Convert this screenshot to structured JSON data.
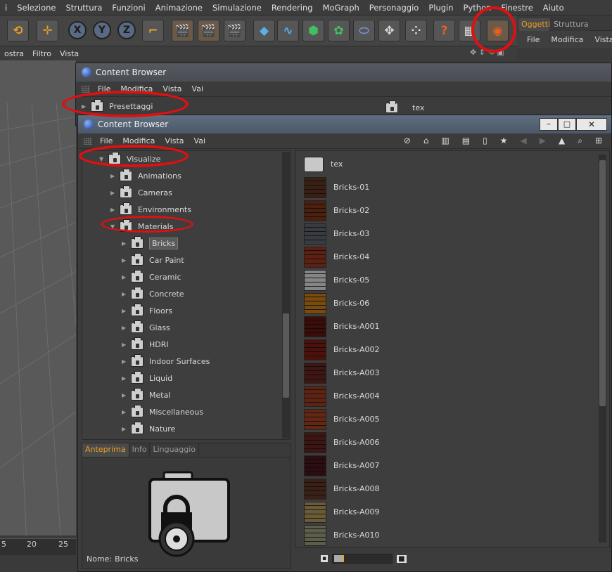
{
  "menubar": [
    "i",
    "Selezione",
    "Struttura",
    "Funzioni",
    "Animazione",
    "Simulazione",
    "Rendering",
    "MoGraph",
    "Personaggio",
    "Plugin",
    "Python",
    "Finestre",
    "Aiuto"
  ],
  "objects_panel": {
    "tabs": [
      "Oggetti",
      "Struttura"
    ],
    "menu": [
      "File",
      "Modifica",
      "Vista"
    ]
  },
  "viewport_menu": [
    "ostra",
    "Filtro",
    "Vista"
  ],
  "timeline_ticks": [
    "5",
    "20",
    "25"
  ],
  "back_window": {
    "title": "Content Browser",
    "menu": [
      "File",
      "Modifica",
      "Vista",
      "Vai"
    ],
    "tree_item": "Presettaggi",
    "right_item": "tex"
  },
  "front_window": {
    "title": "Content Browser",
    "menu": [
      "File",
      "Modifica",
      "Vista",
      "Vai"
    ],
    "tree": [
      {
        "label": "Visualize",
        "level": 0,
        "open": true
      },
      {
        "label": "Animations",
        "level": 1
      },
      {
        "label": "Cameras",
        "level": 1
      },
      {
        "label": "Environments",
        "level": 1
      },
      {
        "label": "Materials",
        "level": 1,
        "open": true
      },
      {
        "label": "Bricks",
        "level": 2,
        "selected": true
      },
      {
        "label": "Car Paint",
        "level": 2
      },
      {
        "label": "Ceramic",
        "level": 2
      },
      {
        "label": "Concrete",
        "level": 2
      },
      {
        "label": "Floors",
        "level": 2
      },
      {
        "label": "Glass",
        "level": 2
      },
      {
        "label": "HDRI",
        "level": 2
      },
      {
        "label": "Indoor Surfaces",
        "level": 2
      },
      {
        "label": "Liquid",
        "level": 2
      },
      {
        "label": "Metal",
        "level": 2
      },
      {
        "label": "Miscellaneous",
        "level": 2
      },
      {
        "label": "Nature",
        "level": 2
      }
    ],
    "preview_tabs": [
      "Anteprima",
      "Info",
      "Linguaggio"
    ],
    "name_label": "Nome:",
    "name_value": "Bricks",
    "items": [
      {
        "label": "tex",
        "color": "#bdbdbd"
      },
      {
        "label": "Bricks-01",
        "color": "#7a5a46"
      },
      {
        "label": "Bricks-02",
        "color": "#8a5a3e"
      },
      {
        "label": "Bricks-03",
        "color": "#777b82"
      },
      {
        "label": "Bricks-04",
        "color": "#9a5a48"
      },
      {
        "label": "Bricks-05",
        "color": "#b8b8b8"
      },
      {
        "label": "Bricks-06",
        "color": "#b08a3e"
      },
      {
        "label": "Bricks-A001",
        "color": "#7b3a2e"
      },
      {
        "label": "Bricks-A002",
        "color": "#8a4232"
      },
      {
        "label": "Bricks-A003",
        "color": "#7e4a44"
      },
      {
        "label": "Bricks-A004",
        "color": "#9a6048"
      },
      {
        "label": "Bricks-A005",
        "color": "#a06448"
      },
      {
        "label": "Bricks-A006",
        "color": "#7c4a44"
      },
      {
        "label": "Bricks-A007",
        "color": "#6a3c44"
      },
      {
        "label": "Bricks-A008",
        "color": "#7a5a4a"
      },
      {
        "label": "Bricks-A009",
        "color": "#a49878"
      },
      {
        "label": "Bricks-A010",
        "color": "#9a9a8a"
      }
    ]
  },
  "colors": {
    "accent": "#f0a020",
    "highlight_ring": "#e01010",
    "selection": "#5a5a5a"
  }
}
